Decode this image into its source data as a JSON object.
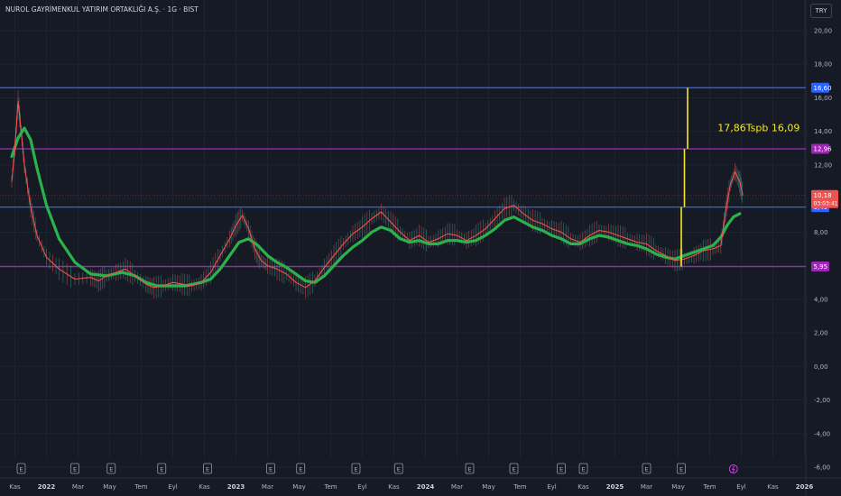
{
  "header": {
    "title": "NUROL GAYRİMENKUL YATIRIM ORTAKLIĞI A.Ş. · 1G · BIST",
    "currency_button": "TRY"
  },
  "chart_data": {
    "type": "line",
    "title": "NUROL GAYRİMENKUL YATIRIM ORTAKLIĞI A.Ş. · 1G · BIST",
    "currency": "TRY",
    "y_axis": {
      "range": [
        -6,
        21
      ],
      "ticks": [
        "20,00",
        "18,00",
        "16,00",
        "14,00",
        "12,00",
        "10,00",
        "8,00",
        "6,00",
        "4,00",
        "2,00",
        "0,00",
        "-2,00",
        "-4,00",
        "-6,00"
      ],
      "tick_values": [
        20,
        18,
        16,
        14,
        12,
        10,
        8,
        6,
        4,
        2,
        0,
        -2,
        -4,
        -6
      ]
    },
    "x_axis": {
      "ticks": [
        {
          "label": "Kas",
          "t": 0.2,
          "bold": false
        },
        {
          "label": "2022",
          "t": 2.2,
          "bold": true
        },
        {
          "label": "Mar",
          "t": 4.2,
          "bold": false
        },
        {
          "label": "May",
          "t": 6.2,
          "bold": false
        },
        {
          "label": "Tem",
          "t": 8.2,
          "bold": false
        },
        {
          "label": "Eyl",
          "t": 10.2,
          "bold": false
        },
        {
          "label": "Kas",
          "t": 12.2,
          "bold": false
        },
        {
          "label": "2023",
          "t": 14.2,
          "bold": true
        },
        {
          "label": "Mar",
          "t": 16.2,
          "bold": false
        },
        {
          "label": "May",
          "t": 18.2,
          "bold": false
        },
        {
          "label": "Tem",
          "t": 20.2,
          "bold": false
        },
        {
          "label": "Eyl",
          "t": 22.2,
          "bold": false
        },
        {
          "label": "Kas",
          "t": 24.2,
          "bold": false
        },
        {
          "label": "2024",
          "t": 26.2,
          "bold": true
        },
        {
          "label": "Mar",
          "t": 28.2,
          "bold": false
        },
        {
          "label": "May",
          "t": 30.2,
          "bold": false
        },
        {
          "label": "Tem",
          "t": 32.2,
          "bold": false
        },
        {
          "label": "Eyl",
          "t": 34.2,
          "bold": false
        },
        {
          "label": "Kas",
          "t": 36.2,
          "bold": false
        },
        {
          "label": "2025",
          "t": 38.2,
          "bold": true
        },
        {
          "label": "Mar",
          "t": 40.2,
          "bold": false
        },
        {
          "label": "May",
          "t": 42.2,
          "bold": false
        },
        {
          "label": "Tem",
          "t": 44.2,
          "bold": false
        },
        {
          "label": "Eyl",
          "t": 46.2,
          "bold": false
        },
        {
          "label": "Kas",
          "t": 48.2,
          "bold": false
        },
        {
          "label": "2026",
          "t": 50.2,
          "bold": true
        }
      ]
    },
    "price_series": {
      "name": "",
      "color": "#ef5350",
      "points": [
        [
          0,
          11
        ],
        [
          0.2,
          13
        ],
        [
          0.4,
          15.8
        ],
        [
          0.6,
          14
        ],
        [
          0.8,
          12
        ],
        [
          1.2,
          9.5
        ],
        [
          1.6,
          7.8
        ],
        [
          2.2,
          6.5
        ],
        [
          3,
          5.8
        ],
        [
          4,
          5.2
        ],
        [
          5,
          5.3
        ],
        [
          5.5,
          5.1
        ],
        [
          6,
          5.4
        ],
        [
          6.6,
          5.6
        ],
        [
          7.2,
          5.8
        ],
        [
          7.8,
          5.4
        ],
        [
          8.5,
          4.9
        ],
        [
          9,
          4.7
        ],
        [
          9.6,
          4.8
        ],
        [
          10.2,
          5.0
        ],
        [
          10.8,
          4.9
        ],
        [
          11.4,
          4.8
        ],
        [
          12,
          5.0
        ],
        [
          12.6,
          5.6
        ],
        [
          13.2,
          6.6
        ],
        [
          13.8,
          7.6
        ],
        [
          14.2,
          8.4
        ],
        [
          14.6,
          9.0
        ],
        [
          15.0,
          8.2
        ],
        [
          15.4,
          7.0
        ],
        [
          15.8,
          6.3
        ],
        [
          16.2,
          6.0
        ],
        [
          16.8,
          5.8
        ],
        [
          17.4,
          5.5
        ],
        [
          18,
          5.0
        ],
        [
          18.6,
          4.7
        ],
        [
          19.2,
          5.1
        ],
        [
          19.8,
          5.9
        ],
        [
          20.4,
          6.6
        ],
        [
          21,
          7.3
        ],
        [
          21.6,
          7.9
        ],
        [
          22.2,
          8.3
        ],
        [
          22.8,
          8.8
        ],
        [
          23.4,
          9.2
        ],
        [
          24,
          8.6
        ],
        [
          24.6,
          8.0
        ],
        [
          25.2,
          7.5
        ],
        [
          25.8,
          7.8
        ],
        [
          26.4,
          7.4
        ],
        [
          27.0,
          7.6
        ],
        [
          27.6,
          7.9
        ],
        [
          28.2,
          7.8
        ],
        [
          28.8,
          7.5
        ],
        [
          29.4,
          7.8
        ],
        [
          30.0,
          8.2
        ],
        [
          30.6,
          8.8
        ],
        [
          31.2,
          9.4
        ],
        [
          31.8,
          9.6
        ],
        [
          32.4,
          9.1
        ],
        [
          33.0,
          8.7
        ],
        [
          33.6,
          8.5
        ],
        [
          34.2,
          8.2
        ],
        [
          34.8,
          8.0
        ],
        [
          35.4,
          7.6
        ],
        [
          36.0,
          7.4
        ],
        [
          36.6,
          7.8
        ],
        [
          37.2,
          8.1
        ],
        [
          37.8,
          8.0
        ],
        [
          38.4,
          7.8
        ],
        [
          39.0,
          7.6
        ],
        [
          39.6,
          7.4
        ],
        [
          40.2,
          7.3
        ],
        [
          40.8,
          6.9
        ],
        [
          41.4,
          6.6
        ],
        [
          42.0,
          6.3
        ],
        [
          42.6,
          6.4
        ],
        [
          43.2,
          6.6
        ],
        [
          43.8,
          6.9
        ],
        [
          44.4,
          7.0
        ],
        [
          44.9,
          7.2
        ],
        [
          45.2,
          9.2
        ],
        [
          45.5,
          10.8
        ],
        [
          45.8,
          11.6
        ],
        [
          46.1,
          11.0
        ],
        [
          46.3,
          10.18
        ]
      ]
    },
    "ema_series": {
      "name": "",
      "color": "#2bb24c",
      "points": [
        [
          0,
          12.5
        ],
        [
          0.4,
          13.6
        ],
        [
          0.8,
          14.2
        ],
        [
          1.2,
          13.5
        ],
        [
          1.6,
          11.8
        ],
        [
          2.2,
          9.6
        ],
        [
          3,
          7.6
        ],
        [
          4,
          6.2
        ],
        [
          5,
          5.5
        ],
        [
          6,
          5.4
        ],
        [
          7,
          5.6
        ],
        [
          7.8,
          5.4
        ],
        [
          8.5,
          5.0
        ],
        [
          9.2,
          4.8
        ],
        [
          10,
          4.8
        ],
        [
          11,
          4.8
        ],
        [
          12,
          5.0
        ],
        [
          12.6,
          5.2
        ],
        [
          13.2,
          5.8
        ],
        [
          13.8,
          6.6
        ],
        [
          14.4,
          7.4
        ],
        [
          15.0,
          7.6
        ],
        [
          15.6,
          7.2
        ],
        [
          16.2,
          6.6
        ],
        [
          16.8,
          6.2
        ],
        [
          17.4,
          5.9
        ],
        [
          18,
          5.5
        ],
        [
          18.6,
          5.1
        ],
        [
          19.2,
          5.0
        ],
        [
          19.8,
          5.4
        ],
        [
          20.4,
          6.0
        ],
        [
          21,
          6.6
        ],
        [
          21.6,
          7.1
        ],
        [
          22.2,
          7.5
        ],
        [
          22.8,
          8.0
        ],
        [
          23.4,
          8.3
        ],
        [
          24,
          8.1
        ],
        [
          24.6,
          7.6
        ],
        [
          25.2,
          7.4
        ],
        [
          25.8,
          7.5
        ],
        [
          26.4,
          7.3
        ],
        [
          27.0,
          7.3
        ],
        [
          27.6,
          7.5
        ],
        [
          28.2,
          7.5
        ],
        [
          28.8,
          7.4
        ],
        [
          29.4,
          7.5
        ],
        [
          30.0,
          7.8
        ],
        [
          30.6,
          8.2
        ],
        [
          31.2,
          8.7
        ],
        [
          31.8,
          8.9
        ],
        [
          32.4,
          8.6
        ],
        [
          33.0,
          8.3
        ],
        [
          33.6,
          8.1
        ],
        [
          34.2,
          7.8
        ],
        [
          34.8,
          7.6
        ],
        [
          35.4,
          7.3
        ],
        [
          36.0,
          7.3
        ],
        [
          36.6,
          7.6
        ],
        [
          37.2,
          7.8
        ],
        [
          37.8,
          7.7
        ],
        [
          38.4,
          7.5
        ],
        [
          39.0,
          7.3
        ],
        [
          39.6,
          7.2
        ],
        [
          40.2,
          7.0
        ],
        [
          40.8,
          6.7
        ],
        [
          41.4,
          6.5
        ],
        [
          42.0,
          6.4
        ],
        [
          42.6,
          6.6
        ],
        [
          43.2,
          6.8
        ],
        [
          43.8,
          7.0
        ],
        [
          44.4,
          7.2
        ],
        [
          44.9,
          7.7
        ],
        [
          45.3,
          8.4
        ],
        [
          45.7,
          8.9
        ],
        [
          46.1,
          9.1
        ]
      ]
    },
    "horizontal_levels": [
      {
        "value": 16.6,
        "label": "16,60",
        "color": "#2962ff"
      },
      {
        "value": 12.96,
        "label": "12,96",
        "color": "#9c27b0"
      },
      {
        "value": 9.49,
        "label": "9,49",
        "color": "#2962ff"
      },
      {
        "value": 5.95,
        "label": "5,95",
        "color": "#9c27b0"
      }
    ],
    "current_price": {
      "value": 10.18,
      "label": "10,18",
      "countdown": "03:03:41",
      "color": "#ef5350"
    },
    "vertical_markers": [
      {
        "t": 42.4,
        "from": 5.95,
        "to": 9.49,
        "color": "#f5e62a"
      },
      {
        "t": 42.6,
        "from": 9.49,
        "to": 12.96,
        "color": "#f5e62a"
      },
      {
        "t": 42.8,
        "from": 12.96,
        "to": 16.6,
        "color": "#f5e62a"
      }
    ],
    "annotation": {
      "text": "17,86Tspb 16,09",
      "t": 44.7,
      "y": 14.0,
      "color": "#f5e62a"
    },
    "events": {
      "earnings_label": "E",
      "earnings_t": [
        0.6,
        4.0,
        6.3,
        9.5,
        12.4,
        16.4,
        18.3,
        21.8,
        24.5,
        29.0,
        31.8,
        34.8,
        36.2,
        40.2,
        42.4
      ],
      "dividend_t": 45.7
    }
  }
}
